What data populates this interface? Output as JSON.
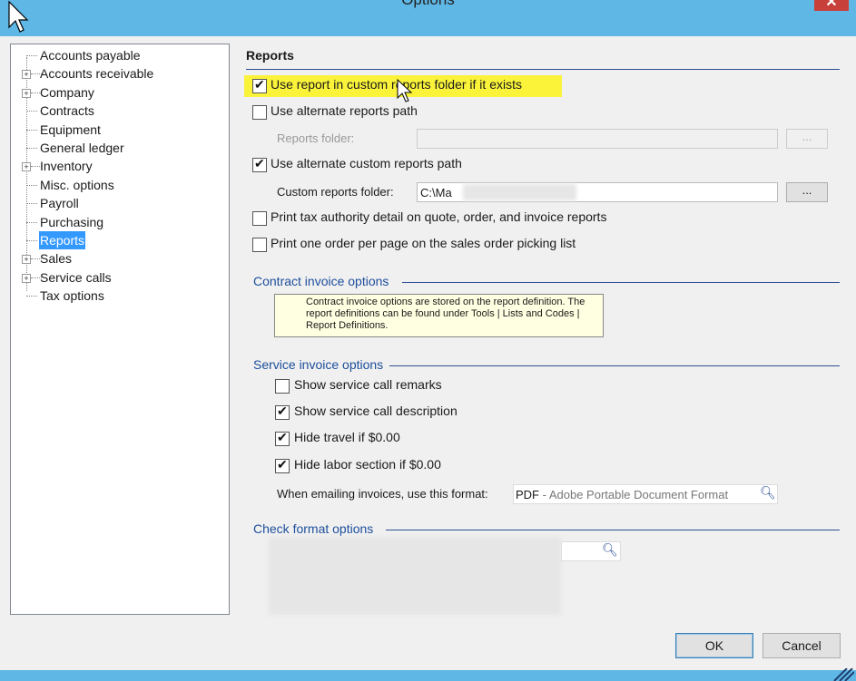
{
  "window": {
    "title": "Options",
    "close_glyph": "✕"
  },
  "tree": {
    "items": [
      {
        "label": "Accounts payable",
        "expandable": false
      },
      {
        "label": "Accounts receivable",
        "expandable": true
      },
      {
        "label": "Company",
        "expandable": true
      },
      {
        "label": "Contracts",
        "expandable": false
      },
      {
        "label": "Equipment",
        "expandable": false
      },
      {
        "label": "General ledger",
        "expandable": false
      },
      {
        "label": "Inventory",
        "expandable": true
      },
      {
        "label": "Misc. options",
        "expandable": false
      },
      {
        "label": "Payroll",
        "expandable": false
      },
      {
        "label": "Purchasing",
        "expandable": false
      },
      {
        "label": "Reports",
        "expandable": false,
        "selected": true
      },
      {
        "label": "Sales",
        "expandable": true
      },
      {
        "label": "Service calls",
        "expandable": true
      },
      {
        "label": "Tax options",
        "expandable": false
      }
    ]
  },
  "reports": {
    "title": "Reports",
    "use_custom_folder": {
      "label": "Use report in custom reports folder if it exists",
      "checked": true
    },
    "use_alt_path": {
      "label": "Use alternate reports path",
      "checked": false
    },
    "reports_folder": {
      "label": "Reports folder:",
      "value": "",
      "browse": "..."
    },
    "use_alt_custom_path": {
      "label": "Use alternate custom reports path",
      "checked": true
    },
    "custom_folder": {
      "label": "Custom reports folder:",
      "value": "C:\\Ma",
      "browse": "..."
    },
    "print_tax": {
      "label": "Print tax authority detail on quote, order, and invoice reports",
      "checked": false
    },
    "print_one_order": {
      "label": "Print one order per page on the sales order picking list",
      "checked": false
    }
  },
  "contract_invoice": {
    "title": "Contract invoice options",
    "note": "Contract invoice options are stored on the report definition. The report definitions can be found under Tools | Lists and Codes | Report Definitions."
  },
  "service_invoice": {
    "title": "Service invoice options",
    "show_remarks": {
      "label": "Show service call remarks",
      "checked": false
    },
    "show_description": {
      "label": "Show service call description",
      "checked": true
    },
    "hide_travel": {
      "label": "Hide travel if $0.00",
      "checked": true
    },
    "hide_labor": {
      "label": "Hide labor section if $0.00",
      "checked": true
    },
    "email_format": {
      "label": "When emailing invoices, use this format:",
      "code": "PDF",
      "desc": " - Adobe Portable Document Format"
    }
  },
  "check_format": {
    "title": "Check format options"
  },
  "buttons": {
    "ok": "OK",
    "cancel": "Cancel"
  },
  "colors": {
    "title_bar": "#5fb7e6",
    "highlight": "#faf33a",
    "selection": "#3399ff",
    "group_title": "#1d4e9c"
  }
}
